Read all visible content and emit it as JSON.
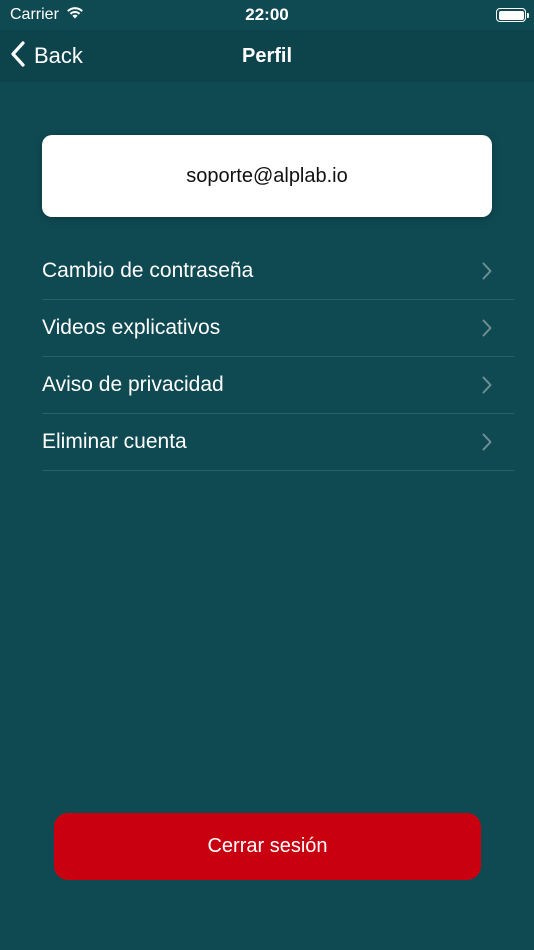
{
  "status_bar": {
    "carrier": "Carrier",
    "time": "22:00",
    "wifi_icon": "wifi-icon",
    "battery_icon": "battery-icon"
  },
  "nav_bar": {
    "back_label": "Back",
    "back_icon": "chevron-left-icon",
    "title": "Perfil"
  },
  "profile": {
    "email": "soporte@alplab.io"
  },
  "menu": {
    "items": [
      {
        "label": "Cambio de contraseña",
        "icon": "chevron-right-icon"
      },
      {
        "label": "Videos explicativos",
        "icon": "chevron-right-icon"
      },
      {
        "label": "Aviso de privacidad",
        "icon": "chevron-right-icon"
      },
      {
        "label": "Eliminar cuenta",
        "icon": "chevron-right-icon"
      }
    ]
  },
  "logout": {
    "label": "Cerrar sesión"
  },
  "colors": {
    "background": "#0f4a53",
    "nav_background": "#0d444c",
    "logout": "#c8000f",
    "card": "#ffffff"
  }
}
